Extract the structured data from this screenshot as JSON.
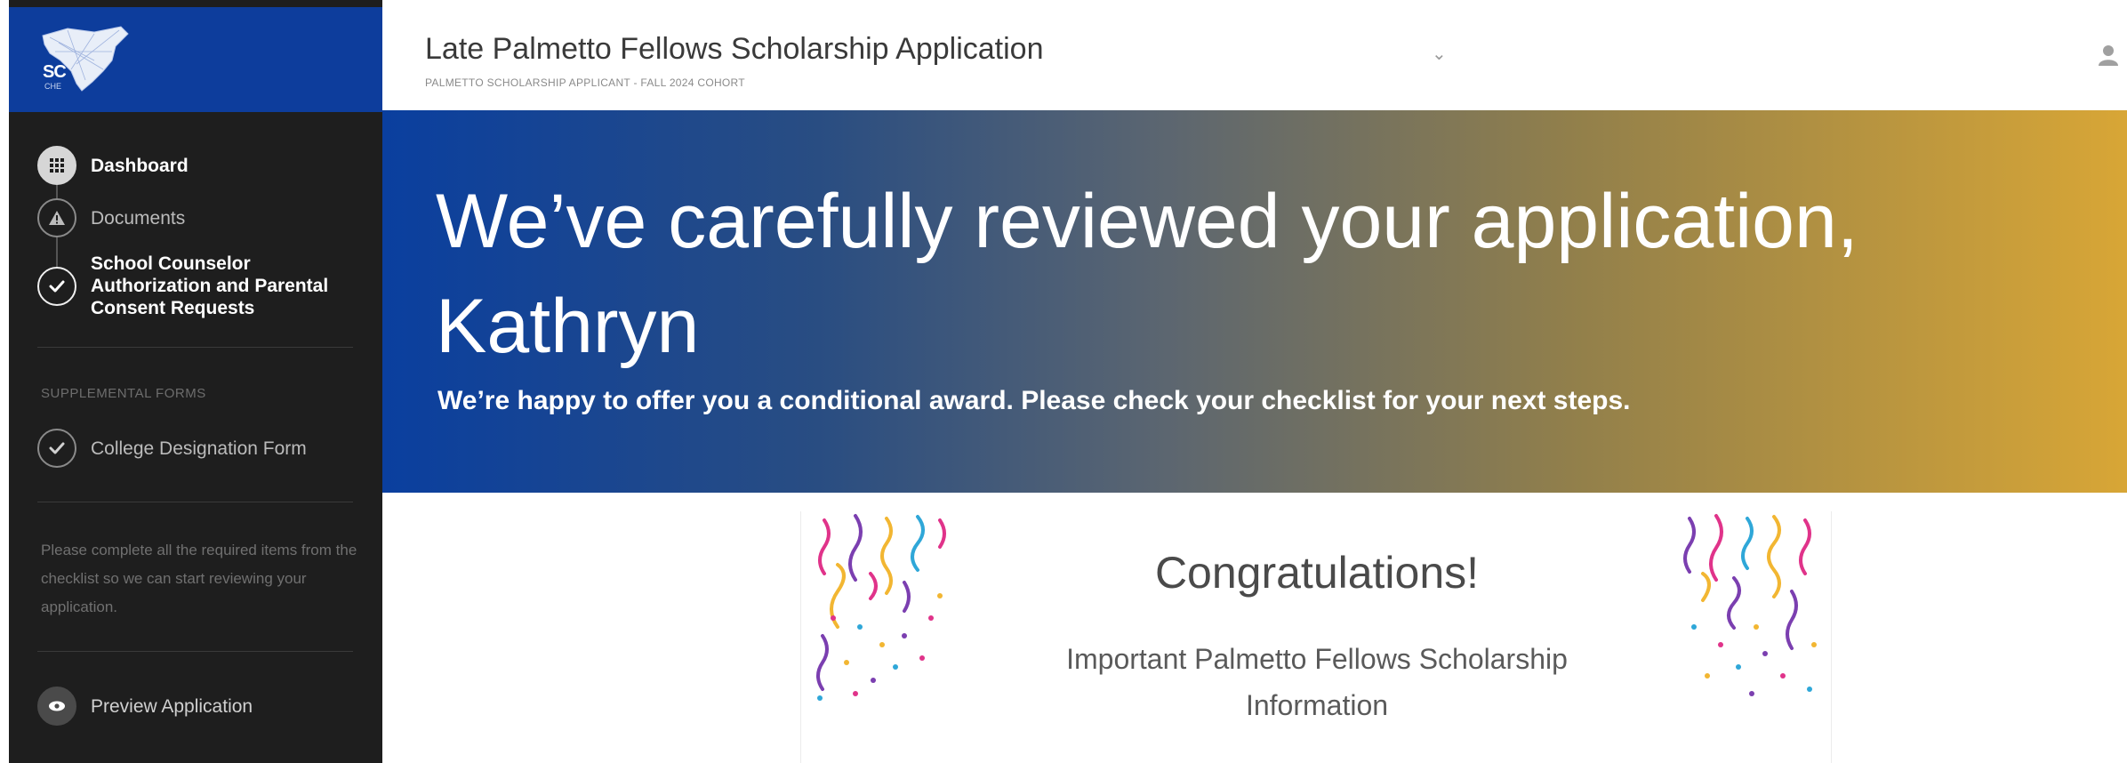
{
  "logo": {
    "text": "SC",
    "subtext": "CHE",
    "icon": "south-carolina-state-icon"
  },
  "sidebar": {
    "nav": [
      {
        "label": "Dashboard",
        "icon": "grid-icon",
        "state": "active"
      },
      {
        "label": "Documents",
        "icon": "warning-icon",
        "state": "default"
      },
      {
        "label": "School Counselor Authorization and Parental Consent Requests",
        "icon": "check-icon",
        "state": "complete"
      }
    ],
    "supplemental_heading": "SUPPLEMENTAL FORMS",
    "supplemental": [
      {
        "label": "College Designation Form",
        "icon": "check-icon"
      }
    ],
    "note": "Please complete all the required items from the checklist so we can start reviewing your application.",
    "preview": {
      "label": "Preview Application",
      "icon": "eye-icon"
    }
  },
  "header": {
    "title": "Late Palmetto Fellows Scholarship Application",
    "subtitle": "PALMETTO SCHOLARSHIP APPLICANT - FALL 2024 COHORT",
    "user_icon": "user-icon"
  },
  "banner": {
    "heading": "We’ve carefully reviewed your application, Kathryn",
    "subheading": "We’re happy to offer you a conditional award. Please check your checklist for your next steps."
  },
  "card": {
    "title": "Congratulations!",
    "subtitle": "Important Palmetto Fellows Scholarship Information"
  },
  "colors": {
    "brand_blue": "#0d3d9c",
    "banner_gold": "#d8a636",
    "sidebar_bg": "#1e1e1e"
  }
}
